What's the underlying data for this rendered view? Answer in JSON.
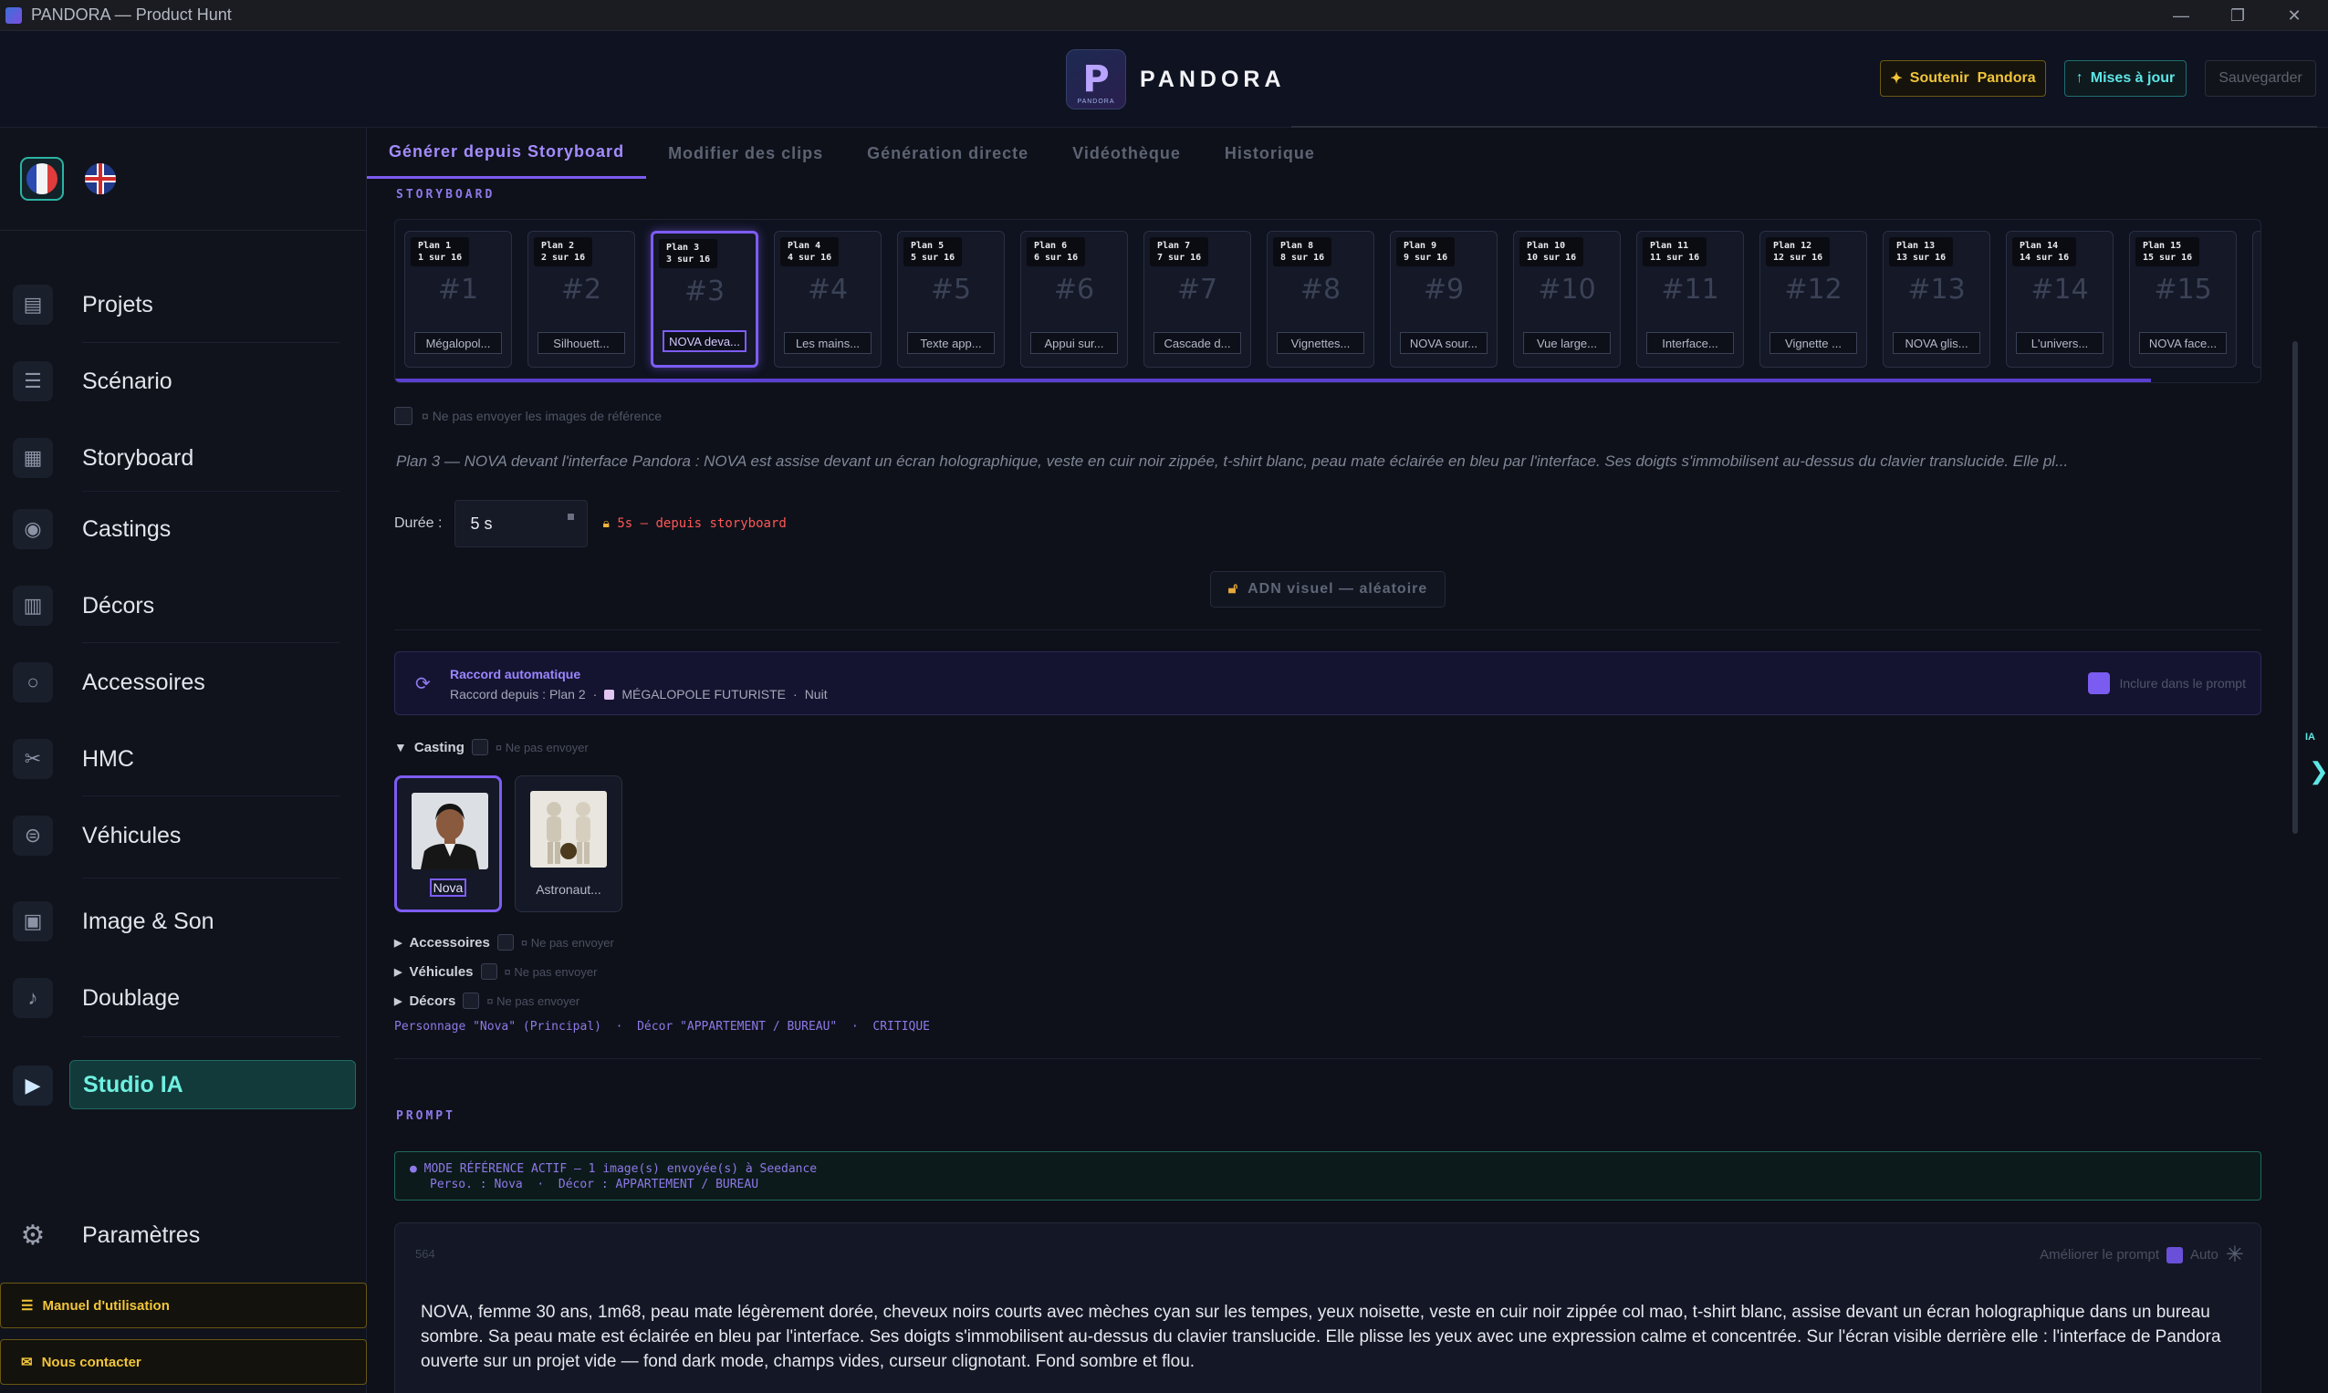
{
  "window": {
    "title": "PANDORA — Product Hunt"
  },
  "header": {
    "brand": "PANDORA",
    "logo_mark": "P",
    "logo_sub": "PANDORA",
    "support_label": "Soutenir  Pandora",
    "support_icon": "✦",
    "updates_label": "Mises à jour",
    "updates_icon": "↑",
    "save_label": "Sauvegarder"
  },
  "sidebar": {
    "items": [
      {
        "label": "Projets",
        "icon": "folder-icon"
      },
      {
        "label": "Scénario",
        "icon": "document-icon"
      },
      {
        "label": "Storyboard",
        "icon": "storyboard-icon"
      },
      {
        "label": "Castings",
        "icon": "person-icon"
      },
      {
        "label": "Décors",
        "icon": "building-icon"
      },
      {
        "label": "Accessoires",
        "icon": "ring-icon"
      },
      {
        "label": "HMC",
        "icon": "makeup-icon"
      },
      {
        "label": "Véhicules",
        "icon": "ufo-icon"
      },
      {
        "label": "Image & Son",
        "icon": "media-icon"
      },
      {
        "label": "Doublage",
        "icon": "mic-icon"
      }
    ],
    "studio_label": "Studio IA",
    "settings_label": "Paramètres",
    "manual_label": "Manuel d'utilisation",
    "contact_label": "Nous contacter"
  },
  "tabs": [
    {
      "label": "Générer depuis Storyboard",
      "active": true
    },
    {
      "label": "Modifier des clips"
    },
    {
      "label": "Génération directe"
    },
    {
      "label": "Vidéothèque"
    },
    {
      "label": "Historique"
    }
  ],
  "storyboard": {
    "section_label": "STORYBOARD",
    "plans": [
      {
        "tag1": "Plan 1",
        "tag2": "1 sur 16",
        "num": "#1",
        "caption": "Mégalopol..."
      },
      {
        "tag1": "Plan 2",
        "tag2": "2 sur 16",
        "num": "#2",
        "caption": "Silhouett..."
      },
      {
        "tag1": "Plan 3",
        "tag2": "3 sur 16",
        "num": "#3",
        "caption": "NOVA deva..."
      },
      {
        "tag1": "Plan 4",
        "tag2": "4 sur 16",
        "num": "#4",
        "caption": "Les mains..."
      },
      {
        "tag1": "Plan 5",
        "tag2": "5 sur 16",
        "num": "#5",
        "caption": "Texte app..."
      },
      {
        "tag1": "Plan 6",
        "tag2": "6 sur 16",
        "num": "#6",
        "caption": "Appui sur..."
      },
      {
        "tag1": "Plan 7",
        "tag2": "7 sur 16",
        "num": "#7",
        "caption": "Cascade d..."
      },
      {
        "tag1": "Plan 8",
        "tag2": "8 sur 16",
        "num": "#8",
        "caption": "Vignettes..."
      },
      {
        "tag1": "Plan 9",
        "tag2": "9 sur 16",
        "num": "#9",
        "caption": "NOVA sour..."
      },
      {
        "tag1": "Plan 10",
        "tag2": "10 sur 16",
        "num": "#10",
        "caption": "Vue large..."
      },
      {
        "tag1": "Plan 11",
        "tag2": "11 sur 16",
        "num": "#11",
        "caption": "Interface..."
      },
      {
        "tag1": "Plan 12",
        "tag2": "12 sur 16",
        "num": "#12",
        "caption": "Vignette ..."
      },
      {
        "tag1": "Plan 13",
        "tag2": "13 sur 16",
        "num": "#13",
        "caption": "NOVA glis..."
      },
      {
        "tag1": "Plan 14",
        "tag2": "14 sur 16",
        "num": "#14",
        "caption": "L'univers..."
      },
      {
        "tag1": "Plan 15",
        "tag2": "15 sur 16",
        "num": "#15",
        "caption": "NOVA face..."
      }
    ],
    "selected_index": 2,
    "no_ref_label": "Ne pas envoyer les images de référence",
    "description": "Plan 3 — NOVA devant l'interface Pandora : NOVA est assise devant un écran holographique, veste en cuir noir zippée, t-shirt blanc, peau mate éclairée en bleu par l'interface. Ses doigts s'immobilisent au-dessus du clavier translucide. Elle pl..."
  },
  "duration": {
    "label": "Durée :",
    "value": "5 s",
    "lock_note": "5s — depuis storyboard"
  },
  "adn_label": "ADN visuel — aléatoire",
  "raccord": {
    "title": "Raccord automatique",
    "source": "Raccord depuis : Plan 2",
    "decor": "MÉGALOPOLE FUTURISTE",
    "time": "Nuit",
    "include_label": "Inclure dans le prompt"
  },
  "casting": {
    "label": "Casting",
    "no_send": "Ne pas envoyer",
    "cards": [
      {
        "name": "Nova",
        "selected": true
      },
      {
        "name": "Astronaut..."
      }
    ]
  },
  "accordions": [
    {
      "label": "Accessoires",
      "no_send": "Ne pas envoyer"
    },
    {
      "label": "Véhicules",
      "no_send": "Ne pas envoyer"
    },
    {
      "label": "Décors",
      "no_send": "Ne pas envoyer"
    }
  ],
  "refs_line": "Personnage \"Nova\" (Principal)  ·  Décor \"APPARTEMENT / BUREAU\"  ·  CRITIQUE",
  "prompt": {
    "section_label": "PROMPT",
    "mode_line1": "● MODE RÉFÉRENCE ACTIF — 1 image(s) envoyée(s) à Seedance",
    "mode_line2": "Perso. : Nova  ·  Décor : APPARTEMENT / BUREAU",
    "char_count": "564",
    "improve_label": "Améliorer le prompt",
    "auto_label": "Auto",
    "text": "NOVA, femme 30 ans, 1m68, peau mate légèrement dorée, cheveux noirs courts avec mèches cyan sur les tempes, yeux noisette, veste en cuir noir zippée col mao, t-shirt blanc, assise devant un écran holographique dans un bureau sombre. Sa peau mate est éclairée en bleu par l'interface. Ses doigts s'immobilisent au-dessus du clavier translucide. Elle plisse les yeux avec une expression calme et concentrée. Sur l'écran visible derrière elle : l'interface de Pandora ouverte sur un projet vide — fond dark mode, champs vides, curseur clignotant. Fond sombre et flou."
  },
  "right_panel": {
    "ia_label": "IA",
    "chevron": "❯"
  },
  "colors": {
    "accent": "#7d5cf4",
    "teal": "#5ee6e6",
    "gold": "#f2c53a",
    "danger": "#ff5656"
  }
}
